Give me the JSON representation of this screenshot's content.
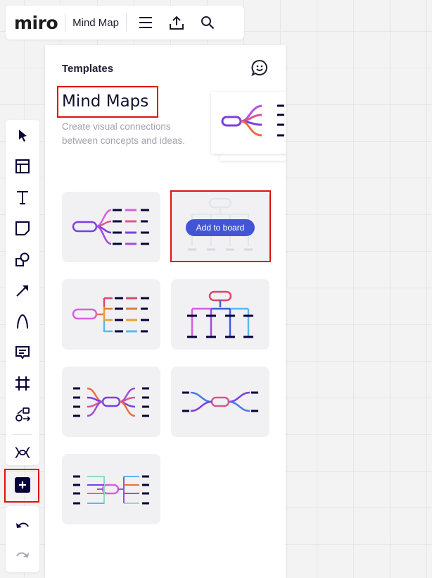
{
  "topbar": {
    "logo": "miro",
    "board_name": "Mind Map",
    "icons": [
      "menu-icon",
      "upload-icon",
      "search-icon"
    ]
  },
  "panel": {
    "title": "Templates",
    "heading": "Mind Maps",
    "description": "Create visual connections between concepts and ideas.",
    "add_to_board": "Add to board",
    "feedback_icon": "smiley-chat-icon"
  },
  "toolbar": {
    "tools": [
      "select",
      "templates",
      "text",
      "sticky-note",
      "shapes",
      "arrow",
      "pen",
      "comment",
      "frame",
      "more-apps",
      "mind-map",
      "add"
    ],
    "undo": "undo",
    "redo": "redo"
  },
  "colors": {
    "accent": "#4255d4",
    "highlight": "#e0110e",
    "dark": "#050038"
  }
}
